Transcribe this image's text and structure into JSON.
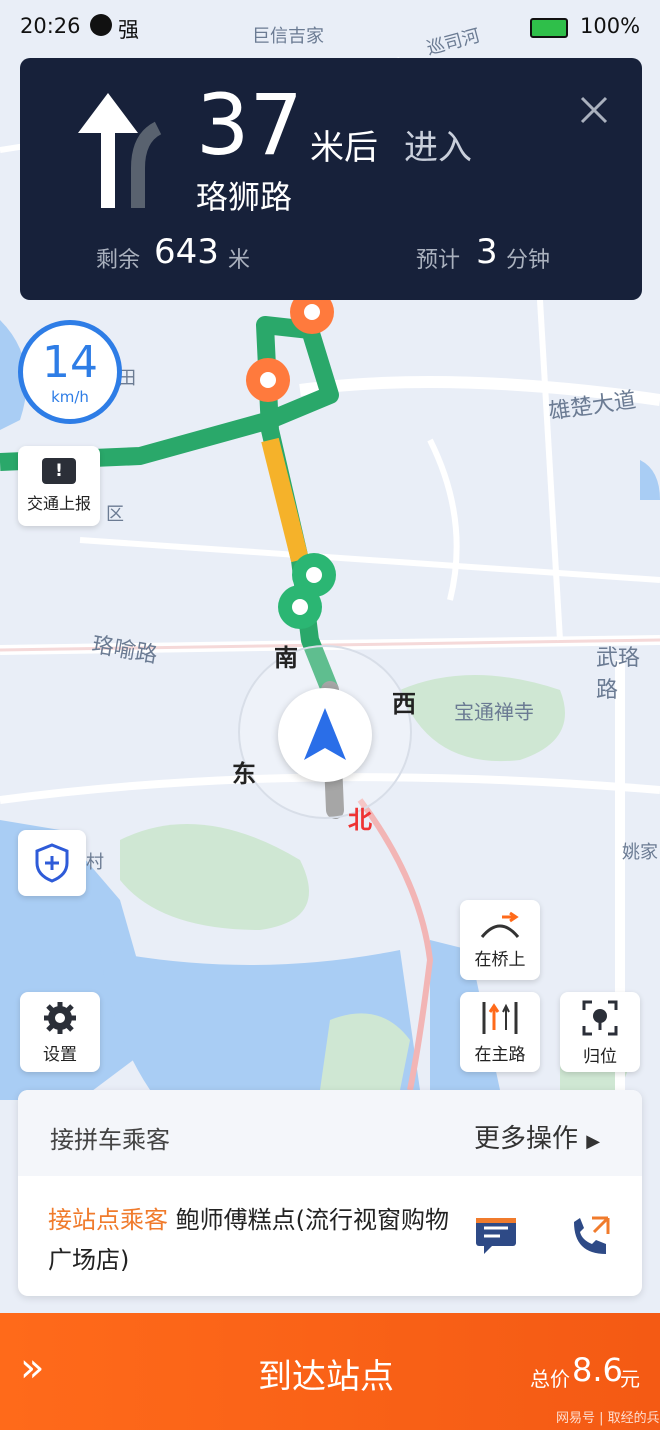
{
  "status": {
    "time": "20:26",
    "signal": "强",
    "battery": "100%"
  },
  "nav": {
    "distance": "37",
    "distance_unit": "米后",
    "action": "进入",
    "road": "珞狮路",
    "remain_label": "剩余",
    "remain_value": "643",
    "remain_unit": "米",
    "eta_label": "预计",
    "eta_value": "3",
    "eta_unit": "分钟"
  },
  "speed": {
    "value": "14",
    "unit": "km/h"
  },
  "map_labels": {
    "xiongchu": "雄楚大道",
    "luoyu": "珞喻路",
    "wuluo": "武珞路",
    "baotong": "宝通禅寺",
    "yaojia": "姚家",
    "xunsi": "巡司河",
    "juxin": "巨信吉家",
    "qu": "区",
    "zhen": "村",
    "shu": "田"
  },
  "compass": {
    "south": "南",
    "west": "西",
    "east": "东",
    "north": "北"
  },
  "buttons": {
    "traffic_report": "交通上报",
    "on_bridge": "在桥上",
    "settings": "设置",
    "main_road": "在主路",
    "recenter": "归位"
  },
  "task": {
    "title": "接拼车乘客",
    "more": "更多操作",
    "tag": "接站点乘客",
    "place": "鲍师傅糕点(流行视窗购物广场店)"
  },
  "arrive": {
    "label": "到达站点",
    "price_label": "总价",
    "price": "8.6",
    "price_unit": "元"
  },
  "watermark": "网易号 | 取经的兵"
}
